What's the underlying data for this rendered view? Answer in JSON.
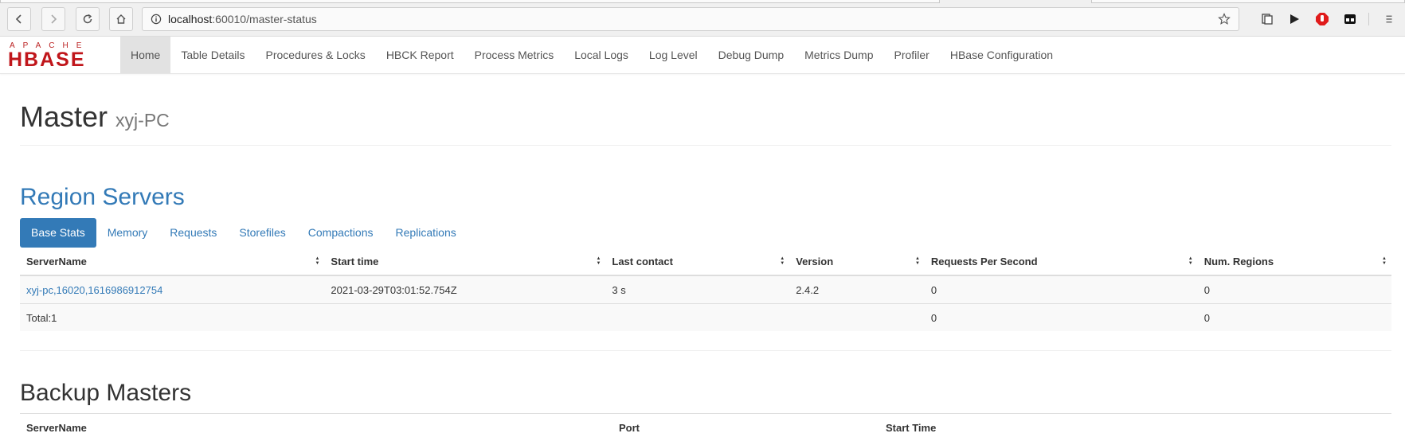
{
  "browser": {
    "url_host": "localhost",
    "url_rest": ":60010/master-status",
    "icons": [
      "back-icon",
      "forward-icon",
      "reload-icon",
      "home-icon",
      "info-icon",
      "bookmark-star-icon",
      "collections-icon",
      "play-icon",
      "adblock-icon",
      "extension-icon",
      "menu-icon"
    ]
  },
  "logo": {
    "top": "APACHE",
    "main": "HBASE"
  },
  "nav": {
    "items": [
      "Home",
      "Table Details",
      "Procedures & Locks",
      "HBCK Report",
      "Process Metrics",
      "Local Logs",
      "Log Level",
      "Debug Dump",
      "Metrics Dump",
      "Profiler",
      "HBase Configuration"
    ],
    "active": "Home"
  },
  "master": {
    "title": "Master",
    "host": "xyj-PC"
  },
  "region_servers": {
    "heading": "Region Servers",
    "tabs": [
      "Base Stats",
      "Memory",
      "Requests",
      "Storefiles",
      "Compactions",
      "Replications"
    ],
    "active_tab": "Base Stats",
    "columns": [
      "ServerName",
      "Start time",
      "Last contact",
      "Version",
      "Requests Per Second",
      "Num. Regions"
    ],
    "rows": [
      {
        "server": "xyj-pc,16020,1616986912754",
        "start": "2021-03-29T03:01:52.754Z",
        "last": "3 s",
        "version": "2.4.2",
        "rps": "0",
        "regions": "0"
      }
    ],
    "total": {
      "label": "Total:1",
      "rps": "0",
      "regions": "0"
    }
  },
  "backup_masters": {
    "heading": "Backup Masters",
    "columns": [
      "ServerName",
      "Port",
      "Start Time"
    ]
  },
  "colors": {
    "link": "#337ab7",
    "logo": "#c0161b",
    "active_tab": "#337ab7"
  }
}
